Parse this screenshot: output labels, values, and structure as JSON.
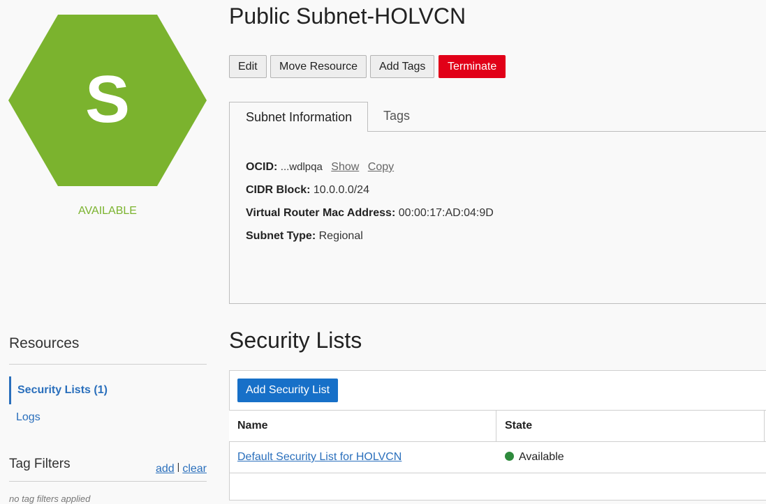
{
  "resource": {
    "icon_letter": "S",
    "status": "AVAILABLE",
    "colors": {
      "hexagon": "#7bb32e",
      "status": "#7bb32e",
      "danger": "#e10018",
      "primary": "#1770c8",
      "link": "#2a6fbc",
      "state_ok": "#2e8a3c"
    }
  },
  "header": {
    "title": "Public Subnet-HOLVCN"
  },
  "actions": {
    "edit": "Edit",
    "move_resource": "Move Resource",
    "add_tags": "Add Tags",
    "terminate": "Terminate"
  },
  "tabs": {
    "subnet_information": "Subnet Information",
    "tags": "Tags"
  },
  "details": {
    "ocid_label": "OCID:",
    "ocid_value": "...wdlpqa",
    "ocid_show": "Show",
    "ocid_copy": "Copy",
    "cidr_label": "CIDR Block:",
    "cidr_value": "10.0.0.0/24",
    "mac_label": "Virtual Router Mac Address:",
    "mac_value": "00:00:17:AD:04:9D",
    "type_label": "Subnet Type:",
    "type_value": "Regional"
  },
  "resources": {
    "title": "Resources",
    "items": [
      {
        "label": "Security Lists (1)"
      },
      {
        "label": "Logs"
      }
    ]
  },
  "tag_filters": {
    "title": "Tag Filters",
    "add": "add",
    "separator": "|",
    "clear": "clear",
    "empty": "no tag filters applied"
  },
  "security_lists": {
    "title": "Security Lists",
    "add_button": "Add Security List",
    "columns": [
      "Name",
      "State"
    ],
    "rows": [
      {
        "name": "Default Security List for HOLVCN",
        "state": "Available"
      }
    ]
  }
}
